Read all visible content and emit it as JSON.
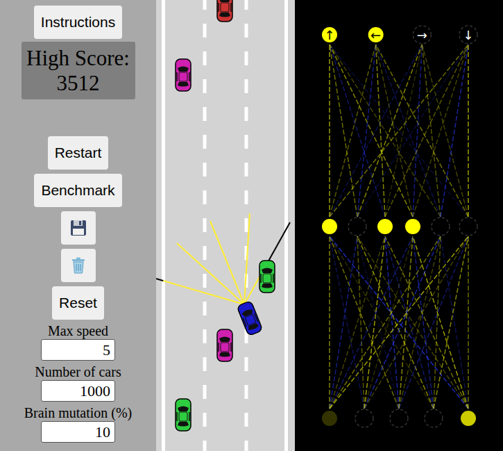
{
  "sidebar": {
    "instructions": "Instructions",
    "high_score": {
      "label": "High Score:",
      "value": "3512"
    },
    "buttons": [
      "Restart",
      "Benchmark",
      "Reset"
    ],
    "fields": [
      {
        "label": "Max speed",
        "value": "5"
      },
      {
        "label": "Number of cars",
        "value": "1000"
      },
      {
        "label": "Brain mutation (%)",
        "value": "10"
      }
    ]
  },
  "road": {
    "cars": [
      {
        "color": "#cc3333",
        "kind": "traffic"
      },
      {
        "color": "#d020b0",
        "kind": "traffic"
      },
      {
        "color": "#2ecc40",
        "kind": "traffic"
      },
      {
        "color": "#d020b0",
        "kind": "traffic"
      },
      {
        "color": "#2ecc40",
        "kind": "traffic"
      },
      {
        "color": "#1a1acc",
        "kind": "player"
      }
    ],
    "sensors": [
      {
        "level": 0.92
      },
      {
        "level": 1
      },
      {
        "level": 1
      },
      {
        "level": 1
      },
      {
        "level": 0.38
      }
    ]
  },
  "network": {
    "outputs": [
      {
        "label": "↑",
        "level": 1
      },
      {
        "label": "←",
        "level": 1
      },
      {
        "label": "→",
        "level": 0
      },
      {
        "label": "↓",
        "level": 0
      }
    ],
    "hidden": [
      {
        "level": 1
      },
      {
        "level": 0
      },
      {
        "level": 1
      },
      {
        "level": 1
      },
      {
        "level": 0
      },
      {
        "level": 0
      }
    ],
    "inputs": [
      {
        "level": 0.2
      },
      {
        "level": 0
      },
      {
        "level": 0
      },
      {
        "level": 0
      },
      {
        "level": 0.8
      }
    ],
    "weights_in": [
      [
        0.6,
        -0.3,
        0.5,
        0.2,
        -0.7
      ],
      [
        -0.5,
        0.4,
        -0.2,
        0.6,
        0.3
      ],
      [
        0.3,
        0.7,
        -0.6,
        -0.4,
        0.5
      ],
      [
        -0.4,
        0.2,
        0.6,
        -0.5,
        0.7
      ],
      [
        0.5,
        -0.6,
        0.3,
        0.4,
        -0.3
      ],
      [
        0.7,
        0.3,
        -0.4,
        0.6,
        0.5
      ]
    ],
    "weights_out": [
      [
        0.7,
        0.5,
        -0.4,
        0.6,
        0.3,
        -0.2
      ],
      [
        0.4,
        -0.5,
        0.6,
        0.3,
        -0.3,
        0.5
      ],
      [
        -0.3,
        0.6,
        0.2,
        -0.5,
        0.4,
        0.3
      ],
      [
        0.5,
        -0.2,
        0.4,
        0.3,
        -0.6,
        0.7
      ]
    ]
  }
}
